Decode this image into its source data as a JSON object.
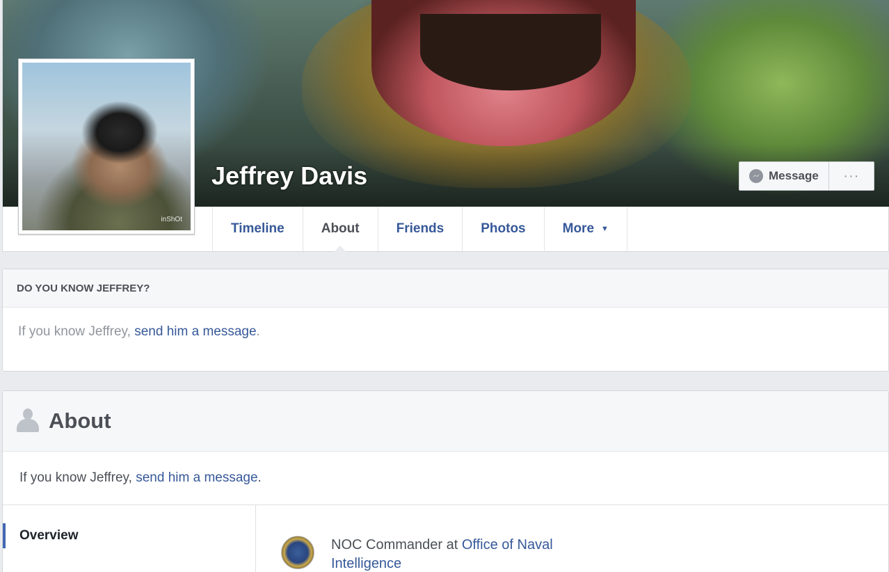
{
  "profile": {
    "name": "Jeffrey Davis",
    "avatar_watermark": "inShOt"
  },
  "cover_actions": {
    "message_label": "Message",
    "more_label": "···"
  },
  "tabs": [
    {
      "label": "Timeline",
      "active": false
    },
    {
      "label": "About",
      "active": true
    },
    {
      "label": "Friends",
      "active": false
    },
    {
      "label": "Photos",
      "active": false
    },
    {
      "label": "More",
      "active": false
    }
  ],
  "know_card": {
    "heading": "DO YOU KNOW JEFFREY?",
    "text_prefix": "If you know Jeffrey, ",
    "link_text": "send him a message",
    "text_suffix": "."
  },
  "about": {
    "title": "About",
    "msg_prefix": "If you know Jeffrey, ",
    "msg_link": "send him a message",
    "msg_suffix": ".",
    "nav": {
      "overview_label": "Overview"
    },
    "work": {
      "prefix": "NOC Commander at ",
      "employer": "Office of Naval Intelligence"
    }
  },
  "colors": {
    "link": "#365899",
    "accent": "#4267b2",
    "page_bg": "#e9ebee"
  }
}
